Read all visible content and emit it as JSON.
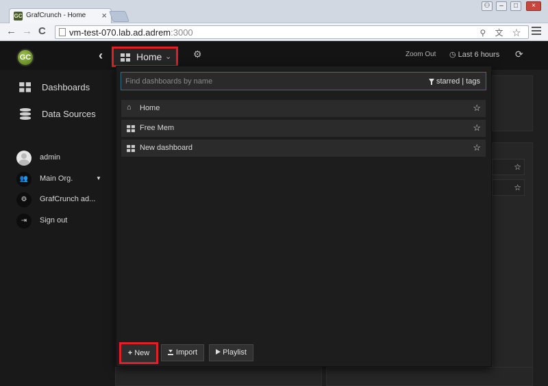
{
  "browser": {
    "tab_title": "GrafCrunch - Home",
    "tab_favicon_text": "GC",
    "tab_close": "×",
    "url_host": "vm-test-070.lab.ad.adrem",
    "url_port": ":3000",
    "back": "←",
    "forward": "→",
    "reload": "C",
    "omni_icons": "⚲ 文 ☆"
  },
  "app": {
    "logo_text": "GC",
    "collapse_glyph": "‹",
    "dashboard_picker": {
      "label": "Home",
      "caret": "⌄"
    },
    "settings_glyph": "⚙",
    "zoom_out": "Zoom Out",
    "time_range": "Last 6 hours",
    "time_icon": "◷",
    "refresh_glyph": "⟳"
  },
  "sidebar": {
    "main_items": [
      {
        "label": "Dashboards",
        "icon": "dashboards-icon"
      },
      {
        "label": "Data Sources",
        "icon": "database-icon"
      }
    ],
    "user_items": [
      {
        "label": "admin",
        "icon": "avatar"
      },
      {
        "label": "Main Org.",
        "icon": "users-icon",
        "glyph": "👥",
        "caret": "▼"
      },
      {
        "label": "GrafCrunch ad...",
        "icon": "cog-icon",
        "glyph": "⚙"
      },
      {
        "label": "Sign out",
        "icon": "sign-out-icon",
        "glyph": "⇥"
      }
    ]
  },
  "search": {
    "placeholder": "Find dashboards by name",
    "filters_label": "starred | tags",
    "results": [
      {
        "label": "Home",
        "icon": "home-icon",
        "glyph": "⌂",
        "star": "☆"
      },
      {
        "label": "Free Mem",
        "icon": "dashboard-grid-icon",
        "star": "☆"
      },
      {
        "label": "New dashboard",
        "icon": "dashboard-grid-icon",
        "star": "☆"
      }
    ],
    "buttons": {
      "new": {
        "label": "New",
        "glyph": "+"
      },
      "import": {
        "label": "Import"
      },
      "playlist": {
        "label": "Playlist"
      }
    }
  },
  "background_stars": [
    "☆",
    "☆"
  ],
  "colors": {
    "highlight": "#e21e26",
    "search_border": "#36708f",
    "logo_green": "#6b9a25"
  }
}
